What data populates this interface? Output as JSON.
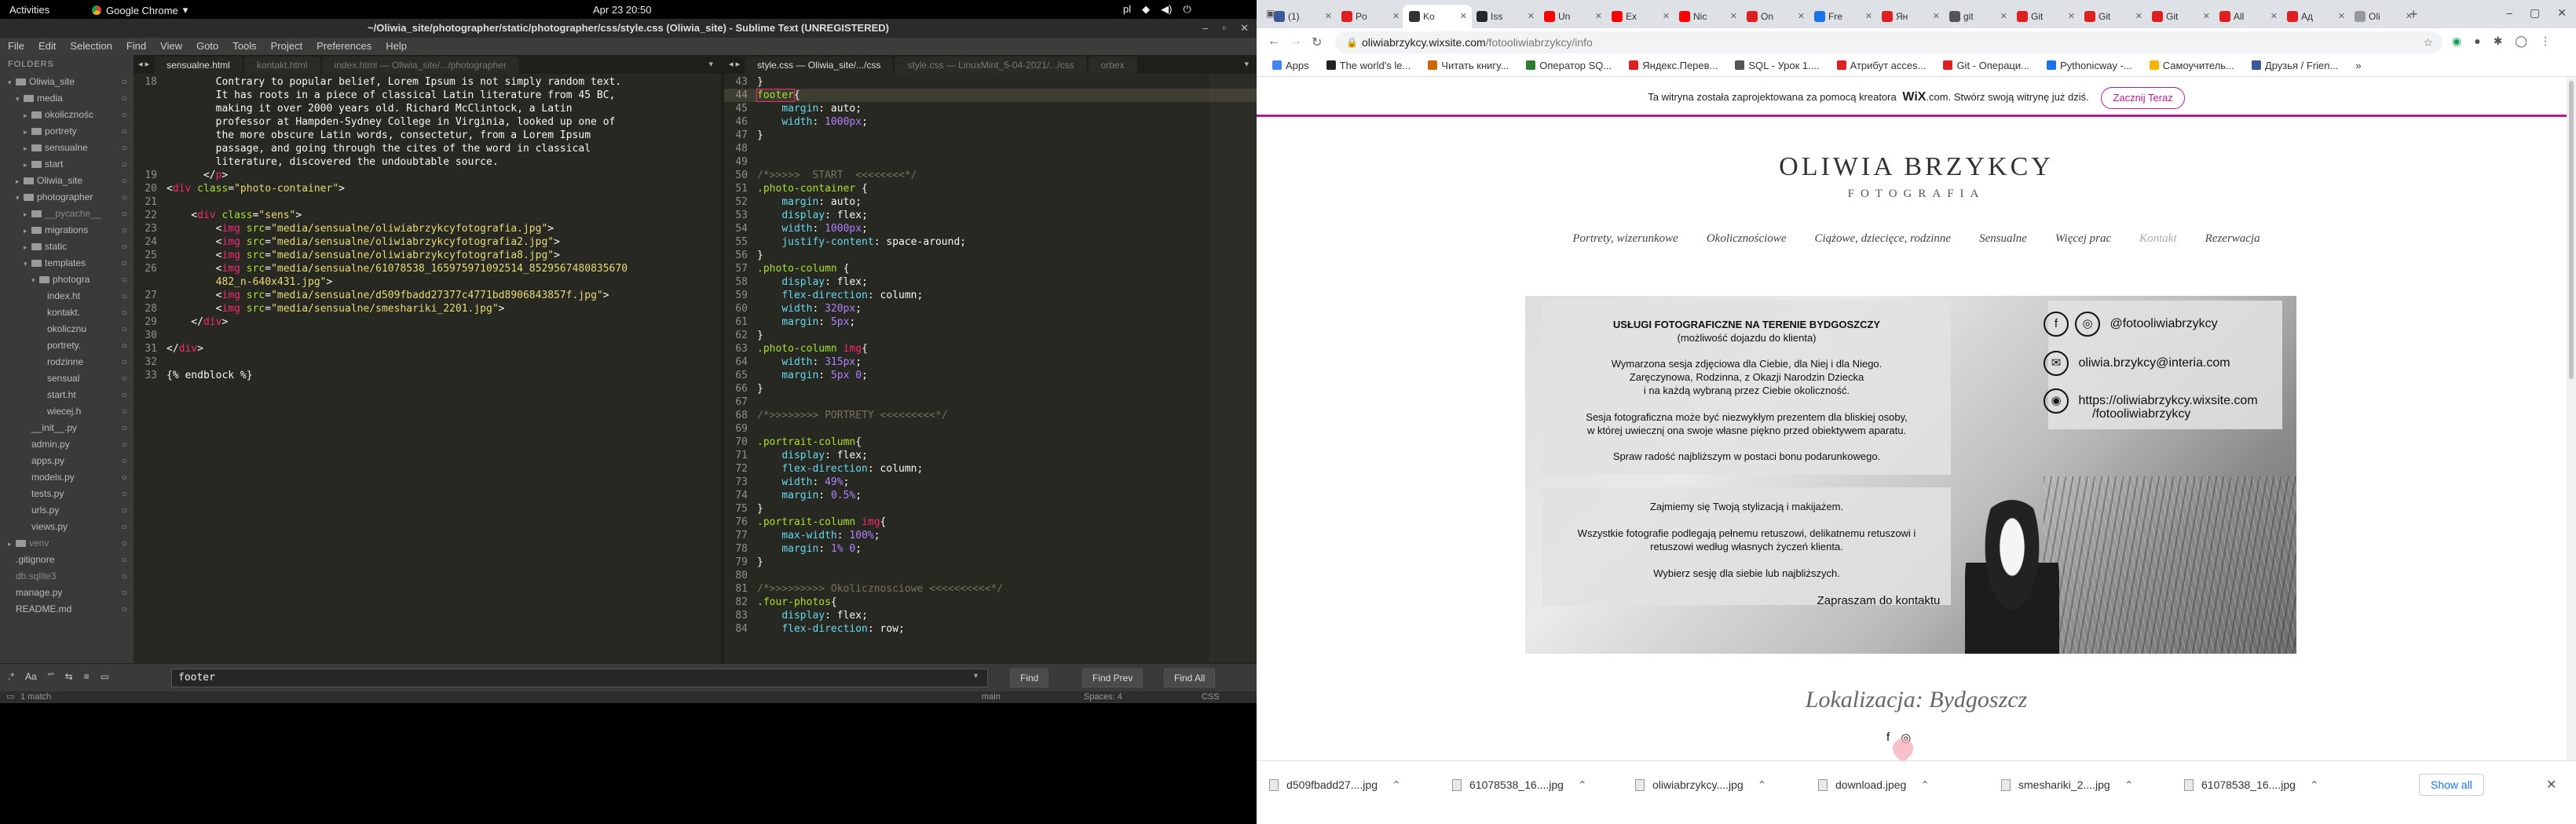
{
  "gnome": {
    "activities": "Activities",
    "app": "Google Chrome",
    "clock": "Apr 23  20:50",
    "lang": "pl"
  },
  "sublime": {
    "title": "~/Oliwia_site/photographer/static/photographer/css/style.css (Oliwia_site) - Sublime Text (UNREGISTERED)",
    "menu": [
      "File",
      "Edit",
      "Selection",
      "Find",
      "View",
      "Goto",
      "Tools",
      "Project",
      "Preferences",
      "Help"
    ],
    "sidebar": {
      "header": "FOLDERS",
      "items": [
        {
          "label": "Oliwia_site",
          "indent": 1,
          "folder": true,
          "open": true
        },
        {
          "label": "media",
          "indent": 2,
          "folder": true,
          "open": true
        },
        {
          "label": "okolicznośc",
          "indent": 3,
          "folder": true
        },
        {
          "label": "portrety",
          "indent": 3,
          "folder": true
        },
        {
          "label": "sensualne",
          "indent": 3,
          "folder": true
        },
        {
          "label": "start",
          "indent": 3,
          "folder": true
        },
        {
          "label": "Oliwia_site",
          "indent": 2,
          "folder": true
        },
        {
          "label": "photographer",
          "indent": 2,
          "folder": true,
          "open": true
        },
        {
          "label": "__pycache__",
          "indent": 3,
          "folder": true,
          "dim": true
        },
        {
          "label": "migrations",
          "indent": 3,
          "folder": true
        },
        {
          "label": "static",
          "indent": 3,
          "folder": true
        },
        {
          "label": "templates",
          "indent": 3,
          "folder": true,
          "open": true
        },
        {
          "label": "photogra",
          "indent": 4,
          "folder": true,
          "open": true
        },
        {
          "label": "index.ht",
          "indent": 5
        },
        {
          "label": "kontakt.",
          "indent": 5
        },
        {
          "label": "okolicznu",
          "indent": 5
        },
        {
          "label": "portrety.",
          "indent": 5
        },
        {
          "label": "rodzinne",
          "indent": 5
        },
        {
          "label": "sensual",
          "indent": 5
        },
        {
          "label": "start.ht",
          "indent": 5
        },
        {
          "label": "wiecej.h",
          "indent": 5
        },
        {
          "label": "__init__.py",
          "indent": 3
        },
        {
          "label": "admin.py",
          "indent": 3
        },
        {
          "label": "apps.py",
          "indent": 3
        },
        {
          "label": "models.py",
          "indent": 3
        },
        {
          "label": "tests.py",
          "indent": 3
        },
        {
          "label": "urls.py",
          "indent": 3
        },
        {
          "label": "views.py",
          "indent": 3
        },
        {
          "label": "venv",
          "indent": 1,
          "folder": true,
          "dim": true
        },
        {
          "label": ".gitignore",
          "indent": 1
        },
        {
          "label": "db.sqlite3",
          "indent": 1,
          "dim": true
        },
        {
          "label": "manage.py",
          "indent": 1
        },
        {
          "label": "README.md",
          "indent": 1
        }
      ]
    },
    "left_tabs": [
      "sensualne.html",
      "kontakt.html",
      "index.html — Oliwia_site/.../photographer"
    ],
    "right_tabs": [
      "style.css — Oliwia_site/.../css",
      "style.css — LinuxMint_5-04-2021/.../css",
      "orbex"
    ],
    "left_code": [
      {
        "n": "18",
        "html": "        Contrary to popular belief, Lorem Ipsum is not simply random text."
      },
      {
        "n": "",
        "html": "        It has roots in a piece of classical Latin literature from 45 BC,"
      },
      {
        "n": "",
        "html": "        making it over 2000 years old. Richard McClintock, a Latin"
      },
      {
        "n": "",
        "html": "        professor at Hampden-Sydney College in Virginia, looked up one of"
      },
      {
        "n": "",
        "html": "        the more obscure Latin words, consectetur, from a Lorem Ipsum"
      },
      {
        "n": "",
        "html": "        passage, and going through the cites of the word in classical"
      },
      {
        "n": "",
        "html": "        literature, discovered the undoubtable source."
      },
      {
        "n": "19",
        "html": "      &lt;/<span class=\"tag\">p</span>&gt;"
      },
      {
        "n": "20",
        "html": "&lt;<span class=\"tag\">div</span> <span class=\"attr\">class</span>=<span class=\"str\">\"photo-container\"</span>&gt;"
      },
      {
        "n": "21",
        "html": ""
      },
      {
        "n": "22",
        "html": "    &lt;<span class=\"tag\">div</span> <span class=\"attr\">class</span>=<span class=\"str\">\"sens\"</span>&gt;"
      },
      {
        "n": "23",
        "html": "        &lt;<span class=\"tag\">img</span> <span class=\"attr\">src</span>=<span class=\"str\">\"media/sensualne/oliwiabrzykcyfotografia.jpg\"</span>&gt;"
      },
      {
        "n": "24",
        "html": "        &lt;<span class=\"tag\">img</span> <span class=\"attr\">src</span>=<span class=\"str\">\"media/sensualne/oliwiabrzykcyfotografia2.jpg\"</span>&gt;"
      },
      {
        "n": "25",
        "html": "        &lt;<span class=\"tag\">img</span> <span class=\"attr\">src</span>=<span class=\"str\">\"media/sensualne/oliwiabrzykcyfotografia8.jpg\"</span>&gt;"
      },
      {
        "n": "26",
        "html": "        &lt;<span class=\"tag\">img</span> <span class=\"attr\">src</span>=<span class=\"str\">\"media/sensualne/61078538_165975971092514_8529567480835670</span>"
      },
      {
        "n": "",
        "html": "<span class=\"str\">        482_n-640x431.jpg\"</span>&gt;"
      },
      {
        "n": "27",
        "html": "        &lt;<span class=\"tag\">img</span> <span class=\"attr\">src</span>=<span class=\"str\">\"media/sensualne/d509fbadd27377c4771bd8906843857f.jpg\"</span>&gt;"
      },
      {
        "n": "28",
        "html": "        &lt;<span class=\"tag\">img</span> <span class=\"attr\">src</span>=<span class=\"str\">\"media/sensualne/smeshariki_2201.jpg\"</span>&gt;"
      },
      {
        "n": "29",
        "html": "    &lt;/<span class=\"tag\">div</span>&gt;"
      },
      {
        "n": "30",
        "html": ""
      },
      {
        "n": "31",
        "html": "&lt;/<span class=\"tag\">div</span>&gt;"
      },
      {
        "n": "32",
        "html": ""
      },
      {
        "n": "33",
        "html": "{% endblock %}"
      }
    ],
    "right_code": [
      {
        "n": "43",
        "html": "}"
      },
      {
        "n": "44",
        "html": "<span class=\"sel hl\">footer</span>{",
        "cur": true
      },
      {
        "n": "45",
        "html": "    <span class=\"prop\">margin</span>: auto;"
      },
      {
        "n": "46",
        "html": "    <span class=\"prop\">width</span>: <span class=\"num\">1000px</span>;"
      },
      {
        "n": "47",
        "html": "}"
      },
      {
        "n": "48",
        "html": ""
      },
      {
        "n": "49",
        "html": ""
      },
      {
        "n": "50",
        "html": "<span class=\"cmt\">/*&gt;&gt;&gt;&gt;&gt;  START  &lt;&lt;&lt;&lt;&lt;&lt;&lt;&lt;*/</span>"
      },
      {
        "n": "51",
        "html": "<span class=\"sel\">.photo-container</span> {"
      },
      {
        "n": "52",
        "html": "    <span class=\"prop\">margin</span>: auto;"
      },
      {
        "n": "53",
        "html": "    <span class=\"prop\">display</span>: flex;"
      },
      {
        "n": "54",
        "html": "    <span class=\"prop\">width</span>: <span class=\"num\">1000px</span>;"
      },
      {
        "n": "55",
        "html": "    <span class=\"prop\">justify-content</span>: space-around;"
      },
      {
        "n": "56",
        "html": "}"
      },
      {
        "n": "57",
        "html": "<span class=\"sel\">.photo-column</span> {"
      },
      {
        "n": "58",
        "html": "    <span class=\"prop\">display</span>: flex;"
      },
      {
        "n": "59",
        "html": "    <span class=\"prop\">flex-direction</span>: column;"
      },
      {
        "n": "60",
        "html": "    <span class=\"prop\">width</span>: <span class=\"num\">320px</span>;"
      },
      {
        "n": "61",
        "html": "    <span class=\"prop\">margin</span>: <span class=\"num\">5px</span>;"
      },
      {
        "n": "62",
        "html": "}"
      },
      {
        "n": "63",
        "html": "<span class=\"sel\">.photo-column</span> <span class=\"tag\">img</span>{"
      },
      {
        "n": "64",
        "html": "    <span class=\"prop\">width</span>: <span class=\"num\">315px</span>;"
      },
      {
        "n": "65",
        "html": "    <span class=\"prop\">margin</span>: <span class=\"num\">5px</span> <span class=\"num\">0</span>;"
      },
      {
        "n": "66",
        "html": "}"
      },
      {
        "n": "67",
        "html": ""
      },
      {
        "n": "68",
        "html": "<span class=\"cmt\">/*&gt;&gt;&gt;&gt;&gt;&gt;&gt;&gt; PORTRETY &lt;&lt;&lt;&lt;&lt;&lt;&lt;&lt;&lt;*/</span>"
      },
      {
        "n": "69",
        "html": ""
      },
      {
        "n": "70",
        "html": "<span class=\"sel\">.portrait-column</span>{"
      },
      {
        "n": "71",
        "html": "    <span class=\"prop\">display</span>: flex;"
      },
      {
        "n": "72",
        "html": "    <span class=\"prop\">flex-direction</span>: column;"
      },
      {
        "n": "73",
        "html": "    <span class=\"prop\">width</span>: <span class=\"num\">49%</span>;"
      },
      {
        "n": "74",
        "html": "    <span class=\"prop\">margin</span>: <span class=\"num\">0.5%</span>;"
      },
      {
        "n": "75",
        "html": "}"
      },
      {
        "n": "76",
        "html": "<span class=\"sel\">.portrait-column</span> <span class=\"tag\">img</span>{"
      },
      {
        "n": "77",
        "html": "    <span class=\"prop\">max-width</span>: <span class=\"num\">100%</span>;"
      },
      {
        "n": "78",
        "html": "    <span class=\"prop\">margin</span>: <span class=\"num\">1%</span> <span class=\"num\">0</span>;"
      },
      {
        "n": "79",
        "html": "}"
      },
      {
        "n": "80",
        "html": ""
      },
      {
        "n": "81",
        "html": "<span class=\"cmt\">/*&gt;&gt;&gt;&gt;&gt;&gt;&gt;&gt;&gt; Okolicznosciowe &lt;&lt;&lt;&lt;&lt;&lt;&lt;&lt;&lt;&lt;*/</span>"
      },
      {
        "n": "82",
        "html": "<span class=\"sel\">.four-photos</span>{"
      },
      {
        "n": "83",
        "html": "    <span class=\"prop\">display</span>: flex;"
      },
      {
        "n": "84",
        "html": "    <span class=\"prop\">flex-direction</span>: row;"
      }
    ],
    "find": {
      "query": "footer",
      "find_label": "Find",
      "find_prev_label": "Find Prev",
      "find_all_label": "Find All"
    },
    "status": {
      "left": "1 match",
      "branch": "main",
      "spaces": "Spaces: 4",
      "syntax": "CSS"
    }
  },
  "chrome": {
    "tabs": [
      {
        "label": "(1)",
        "color": "#3b5998"
      },
      {
        "label": "Po",
        "color": "#e02020"
      },
      {
        "label": "Ko",
        "color": "#333333",
        "active": true
      },
      {
        "label": "Iss",
        "color": "#24292e"
      },
      {
        "label": "Un",
        "color": "#ff0000"
      },
      {
        "label": "Ex",
        "color": "#ff0000"
      },
      {
        "label": "Nic",
        "color": "#ff0000"
      },
      {
        "label": "On",
        "color": "#e02020"
      },
      {
        "label": "Fre",
        "color": "#1a73e8"
      },
      {
        "label": "Ян",
        "color": "#e02020"
      },
      {
        "label": "git",
        "color": "#555555"
      },
      {
        "label": "Git",
        "color": "#e02020"
      },
      {
        "label": "Git",
        "color": "#e02020"
      },
      {
        "label": "Git",
        "color": "#e02020"
      },
      {
        "label": "All",
        "color": "#e02020"
      },
      {
        "label": "Ад",
        "color": "#e02020"
      },
      {
        "label": "Oli",
        "color": "#999999"
      }
    ],
    "url_host": "oliwiabrzykcy.wixsite.com",
    "url_path": "/fotooliwiabrzykcy/info",
    "bookmarks": [
      {
        "label": "Apps",
        "color": "#4285f4"
      },
      {
        "label": "The world's le...",
        "color": "#222222"
      },
      {
        "label": "Читать книгу...",
        "color": "#cc6600"
      },
      {
        "label": "Оператор SQ...",
        "color": "#2e7d32"
      },
      {
        "label": "Яндекс.Перев...",
        "color": "#e02020"
      },
      {
        "label": "SQL - Урок 1....",
        "color": "#555555"
      },
      {
        "label": "Атрибут acces...",
        "color": "#e02020"
      },
      {
        "label": "Git - Операци...",
        "color": "#e02020"
      },
      {
        "label": "Pythonicway -...",
        "color": "#1a73e8"
      },
      {
        "label": "Самоучитель...",
        "color": "#f4b400"
      },
      {
        "label": "Друзья / Frien...",
        "color": "#3b5998"
      }
    ],
    "wix": {
      "text": "Ta witryna została zaprojektowana za pomocą kreatora",
      "brand": "WiX",
      "text2": ".com. Stwórz swoją witrynę już dziś.",
      "cta": "Zacznij Teraz"
    },
    "site": {
      "title": "OLIWIA BRZYKCY",
      "subtitle": "FOTOGRAFIA",
      "nav": [
        "Portrety, wizerunkowe",
        "Okolicznościowe",
        "Ciążowe, dziecięce, rodzinne",
        "Sensualne",
        "Więcej prac",
        "Kontakt",
        "Rezerwacja"
      ],
      "promo": {
        "heading": "USŁUGI FOTOGRAFICZNE NA TERENIE BYDGOSZCZY",
        "heading2": "(możliwość dojazdu do klienta)",
        "p1a": "Wymarzona sesja zdjęciowa dla Ciebie, dla Niej i dla Niego.",
        "p1b": "Zaręczynowa, Rodzinna, z Okazji Narodzin Dziecka",
        "p1c": "i na każdą wybraną przez Ciebie okoliczność.",
        "p2a": "Sesja fotograficzna może być niezwykłym prezentem dla bliskiej osoby,",
        "p2b": "w której uwiecznį ona swoje własne piękno przed obiektywem aparatu.",
        "p3": "Spraw radość najbliższym w postaci bonu podarunkowego.",
        "p4": "Zajmiemy się Twoją stylizacją i makijażem.",
        "p5a": "Wszystkie fotografie podlegają pełnemu retuszowi, delikatnemu retuszowi i",
        "p5b": "retuszowi według własnych życzeń klienta.",
        "p6": "Wybierz sesję dla siebie lub najbliższych.",
        "p7": "Zapraszam do kontaktu",
        "social": [
          "@fotooliwiabrzykcy",
          "oliwia.brzykcy@interia.com",
          "https://oliwiabrzykcy.wixsite.com",
          "/fotooliwiabrzykcy"
        ]
      },
      "location": "Lokalizacja: Bydgoszcz"
    },
    "downloads": [
      "d509fbadd27....jpg",
      "61078538_16....jpg",
      "oliwiabrzykcy....jpg",
      "download.jpeg",
      "smeshariki_2....jpg",
      "61078538_16....jpg"
    ],
    "show_all": "Show all"
  }
}
